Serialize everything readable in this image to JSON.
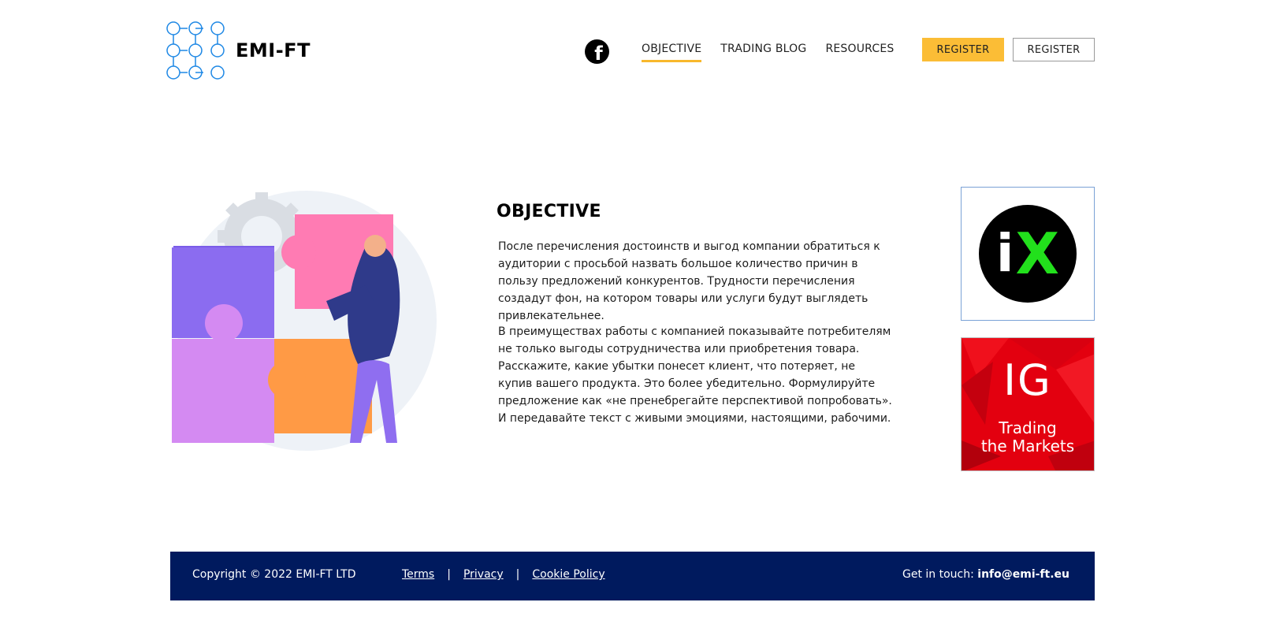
{
  "header": {
    "logo_text": "EMI-FT",
    "nav": [
      {
        "label": "OBJECTIVE",
        "active": true
      },
      {
        "label": "TRADING BLOG",
        "active": false
      },
      {
        "label": "RESOURCES",
        "active": false
      }
    ],
    "register_primary": "REGISTER",
    "register_secondary": "REGISTER",
    "accent_color": "#fbbd36",
    "social_icon": "facebook-icon"
  },
  "main": {
    "title": "OBJECTIVE",
    "paragraph1": "После перечисления достоинств и выгод компании обратиться к аудитории с просьбой назвать большое количество причин в пользу предложений конкурентов. Трудности перечисления создадут фон, на котором товары или услуги будут выглядеть привлекательнее.",
    "paragraph2": "В преимуществах работы с компанией показывайте потребителям не только выгоды сотрудничества или приобретения товара. Расскажите, какие убытки понесет клиент, что потеряет, не купив вашего продукта. Это более убедительно. Формулируйте предложение как «не пренебрегайте перспективой попробовать». И передавайте текст с живыми эмоциями, настоящими, рабочими."
  },
  "partners": {
    "ix": {
      "i": "i",
      "x": "X"
    },
    "ig": {
      "letters": "IG",
      "line1": "Trading",
      "line2": "the Markets"
    }
  },
  "footer": {
    "copyright": "Copyright © 2022 EMI-FT LTD",
    "links": [
      "Terms",
      "Privacy",
      "Cookie Policy"
    ],
    "separator": "|",
    "contact_label": "Get in touch: ",
    "email": "info@emi-ft.eu",
    "background": "#001a5e"
  }
}
